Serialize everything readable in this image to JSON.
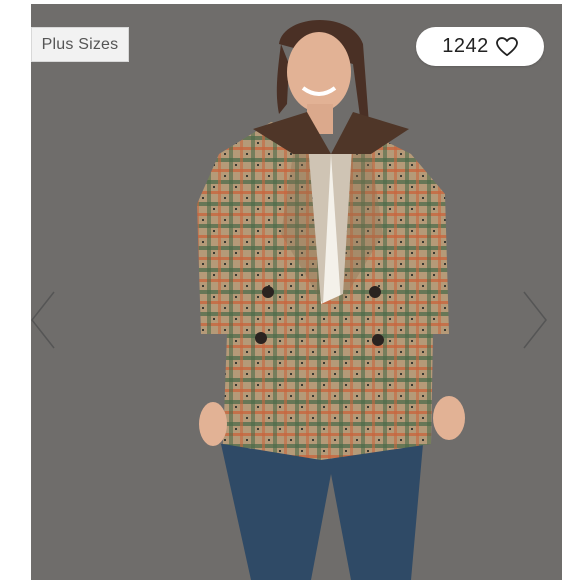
{
  "badge": {
    "label": "Plus Sizes"
  },
  "likes": {
    "count": "1242",
    "icon": "heart-outline-icon"
  },
  "navigation": {
    "prev_icon": "chevron-left-icon",
    "next_icon": "chevron-right-icon"
  },
  "colors": {
    "backdrop": "#6f6d6b",
    "badge_bg": "#f2f2f2",
    "pill_bg": "#ffffff",
    "arrow": "#555555"
  }
}
